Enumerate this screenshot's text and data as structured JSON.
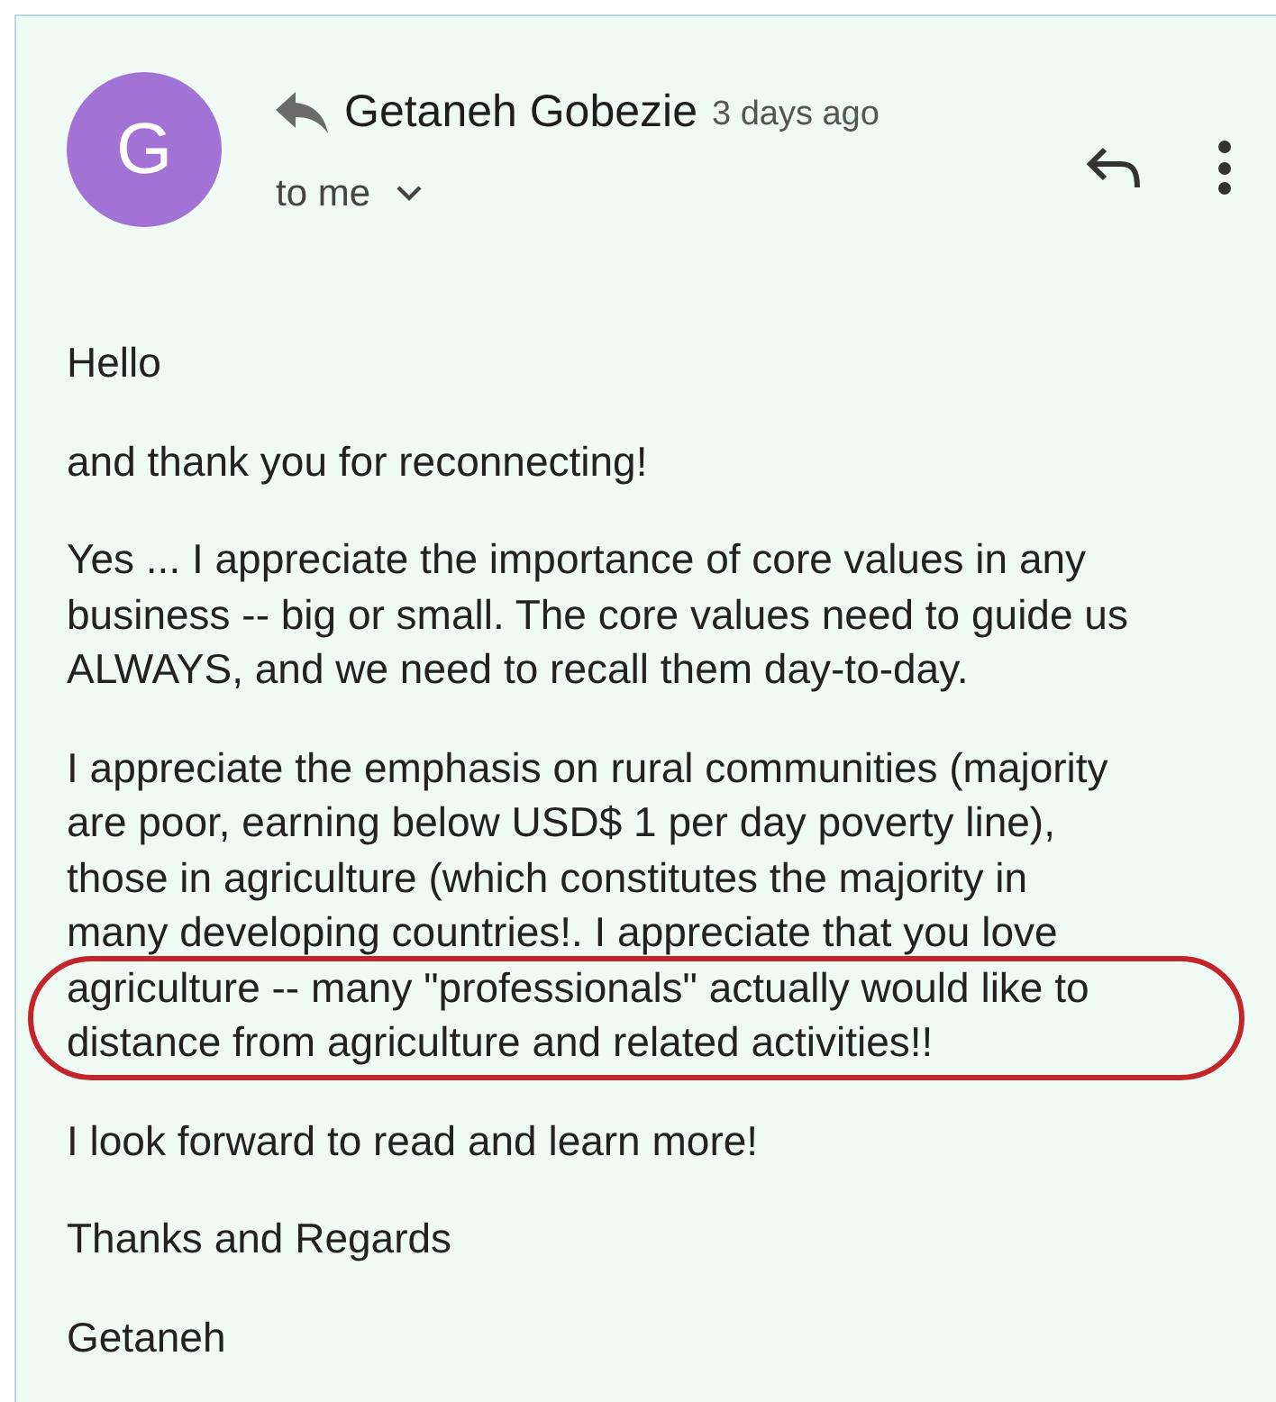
{
  "sender": {
    "initial": "G",
    "name": "Getaneh Gobezie",
    "time": "3 days ago",
    "recipient": "to me"
  },
  "body": [
    {
      "lines": [
        "Hello"
      ]
    },
    {
      "lines": [
        "and thank you for reconnecting!"
      ]
    },
    {
      "lines": [
        "Yes ... I appreciate the importance of core values in any",
        "business -- big or small. The core values need to guide us",
        "ALWAYS, and we need to recall them day-to-day."
      ]
    },
    {
      "lines": [
        "I appreciate the emphasis on rural communities (majority",
        "are poor, earning below USD$ 1 per day poverty line),",
        "those in agriculture (which constitutes the majority in",
        "many developing countries!. I appreciate that you love"
      ],
      "circled_lines": [
        "agriculture -- many \"professionals\" actually would like to",
        "distance from agriculture and related activities!!"
      ]
    },
    {
      "lines": [
        "I look forward to read and learn more!"
      ]
    },
    {
      "lines": [
        "Thanks and Regards"
      ]
    },
    {
      "lines": [
        "Getaneh"
      ]
    }
  ]
}
